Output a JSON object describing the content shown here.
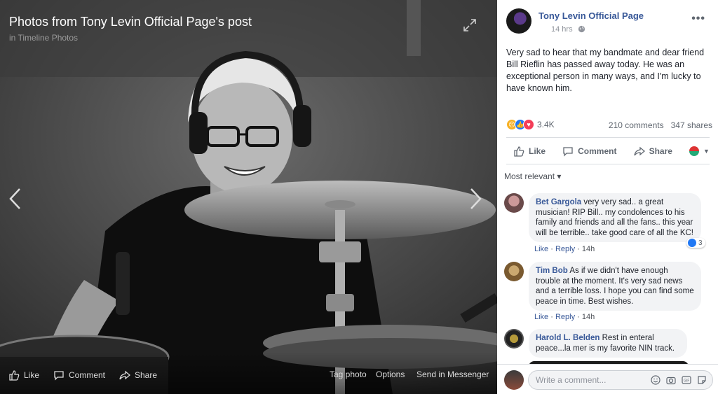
{
  "viewer": {
    "title": "Photos from Tony Levin Official Page's post",
    "subtitle": "in Timeline Photos",
    "bottom_actions": {
      "like": "Like",
      "comment": "Comment",
      "share": "Share",
      "tag_photo": "Tag photo",
      "options": "Options",
      "send_messenger": "Send in Messenger"
    }
  },
  "post": {
    "page_name": "Tony Levin Official Page",
    "time": "14 hrs",
    "text": "Very sad to hear that my bandmate and dear friend Bill Rieflin has passed away today. He was an exceptional person in many ways, and I'm lucky to have known him.",
    "reaction_count": "3.4K",
    "comments_count": "210 comments",
    "shares_count": "347 shares",
    "actions": {
      "like": "Like",
      "comment": "Comment",
      "share": "Share"
    },
    "sort_label": "Most relevant ▾"
  },
  "comments": [
    {
      "author": "Bet Gargola",
      "text": "very very sad.. a great musician! RIP Bill.. my condolences to his family and friends and all the fans.. this year will be terrible.. take good care of all the KC!",
      "like": "Like",
      "reply": "Reply",
      "time": "14h",
      "reaction_count": "3"
    },
    {
      "author": "Tim Bob",
      "text": "As if we didn't have enough trouble at the moment. It's very sad news and a terrible loss. I hope you can find some peace in time. Best wishes.",
      "like": "Like",
      "reply": "Reply",
      "time": "14h"
    },
    {
      "author": "Harold L. Belden",
      "text": "Rest in enteral peace...la mer is my favorite NIN track."
    }
  ],
  "composer": {
    "placeholder": "Write a comment..."
  },
  "colors": {
    "link": "#385898",
    "like_blue": "#2078f4",
    "heart_red": "#f33e58",
    "sad_yellow": "#f7b125"
  }
}
